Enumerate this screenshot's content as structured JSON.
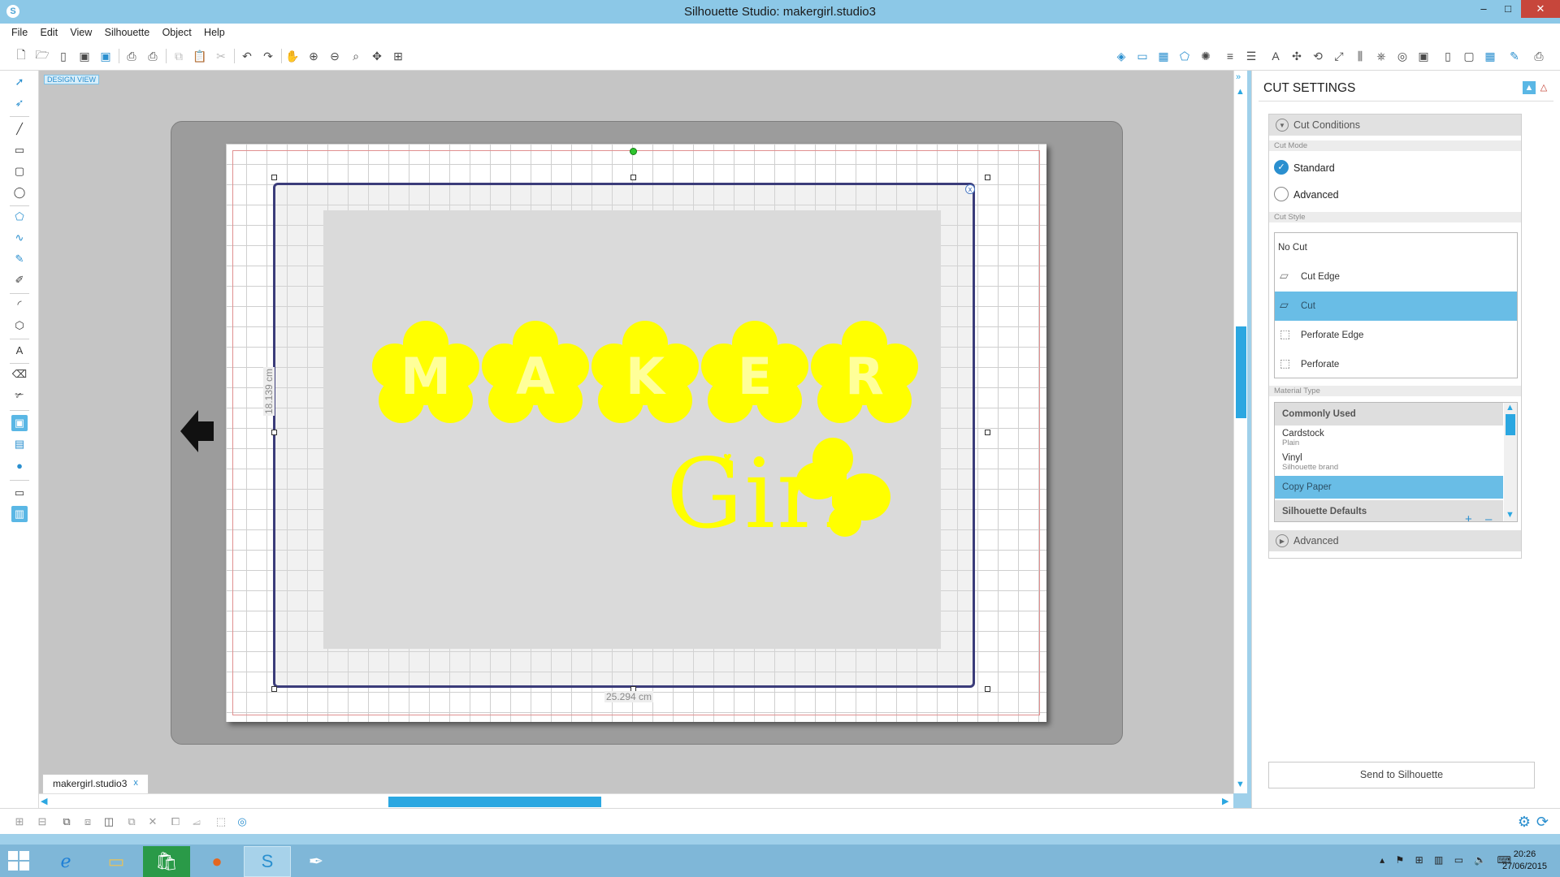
{
  "window": {
    "title": "Silhouette Studio: makergirl.studio3",
    "app_icon_glyph": "S",
    "minimize": "–",
    "maximize": "□",
    "close": "✕"
  },
  "menu": [
    "File",
    "Edit",
    "View",
    "Silhouette",
    "Object",
    "Help"
  ],
  "canvas": {
    "view_label": "DESIGN VIEW",
    "width_label": "25.294 cm",
    "height_label": "18.139 cm",
    "design_letters": [
      "M",
      "A",
      "K",
      "E",
      "R"
    ],
    "design_subtext": "Girl",
    "close_glyph": "x"
  },
  "file_tab": {
    "name": "makergirl.studio3",
    "close": "x"
  },
  "panel": {
    "title": "CUT SETTINGS",
    "cut_conditions": "Cut Conditions",
    "cut_mode_label": "Cut Mode",
    "cut_modes": [
      {
        "label": "Standard",
        "selected": true
      },
      {
        "label": "Advanced",
        "selected": false
      }
    ],
    "cut_style_label": "Cut Style",
    "cut_styles": [
      {
        "label": "No Cut",
        "selected": false
      },
      {
        "label": "Cut Edge",
        "selected": false
      },
      {
        "label": "Cut",
        "selected": true
      },
      {
        "label": "Perforate Edge",
        "selected": false
      },
      {
        "label": "Perforate",
        "selected": false
      }
    ],
    "material_type_label": "Material Type",
    "materials": {
      "group": "Commonly Used",
      "items": [
        {
          "label": "Cardstock",
          "sub": "Plain"
        },
        {
          "label": "Vinyl",
          "sub": "Silhouette brand"
        }
      ],
      "selected": "Copy Paper",
      "defaults_group": "Silhouette Defaults",
      "add": "+",
      "remove": "–"
    },
    "advanced_section": "Advanced",
    "send_button": "Send to Silhouette"
  },
  "taskbar": {
    "clock_time": "20:26",
    "clock_date": "27/06/2015"
  },
  "colors": {
    "accent": "#2a8fcf",
    "selection": "#69bde6",
    "design": "#ffff00",
    "cut_border": "#3b3c7a"
  }
}
